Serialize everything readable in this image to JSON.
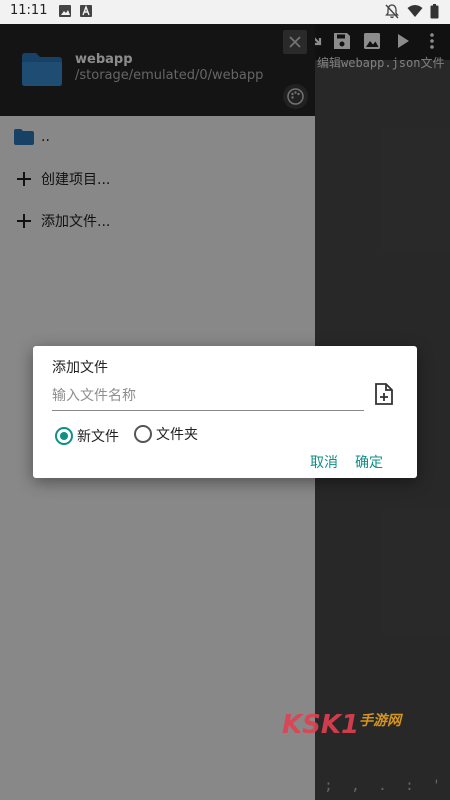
{
  "status_bar": {
    "time": "11:11",
    "icons": [
      "image-icon",
      "text-a-icon",
      "notifications-off-icon",
      "wifi-icon",
      "battery-icon"
    ]
  },
  "toolbar": {
    "icons": [
      "import-icon",
      "save-icon",
      "image-icon",
      "play-icon",
      "more-vert-icon"
    ],
    "subtitle": "编辑webapp.json文件"
  },
  "drawer": {
    "title": "webapp",
    "path": "/storage/emulated/0/webapp",
    "items": [
      {
        "label": "..",
        "icon": "folder-icon"
      },
      {
        "label": "创建项目...",
        "icon": "plus-icon"
      },
      {
        "label": "添加文件...",
        "icon": "plus-icon"
      }
    ]
  },
  "dialog": {
    "title": "添加文件",
    "input_placeholder": "输入文件名称",
    "input_value": "",
    "radio_new_file": "新文件",
    "radio_folder": "文件夹",
    "selected": "新文件",
    "cancel": "取消",
    "confirm": "确定"
  },
  "bottom_keys": [
    ";",
    ",",
    ".",
    ":",
    "'"
  ],
  "watermark": {
    "brand": "KSK1",
    "text": "手游网"
  },
  "colors": {
    "accent": "#0f8f86",
    "drawer_header": "#262626",
    "toolbar": "#1f1f1f"
  }
}
